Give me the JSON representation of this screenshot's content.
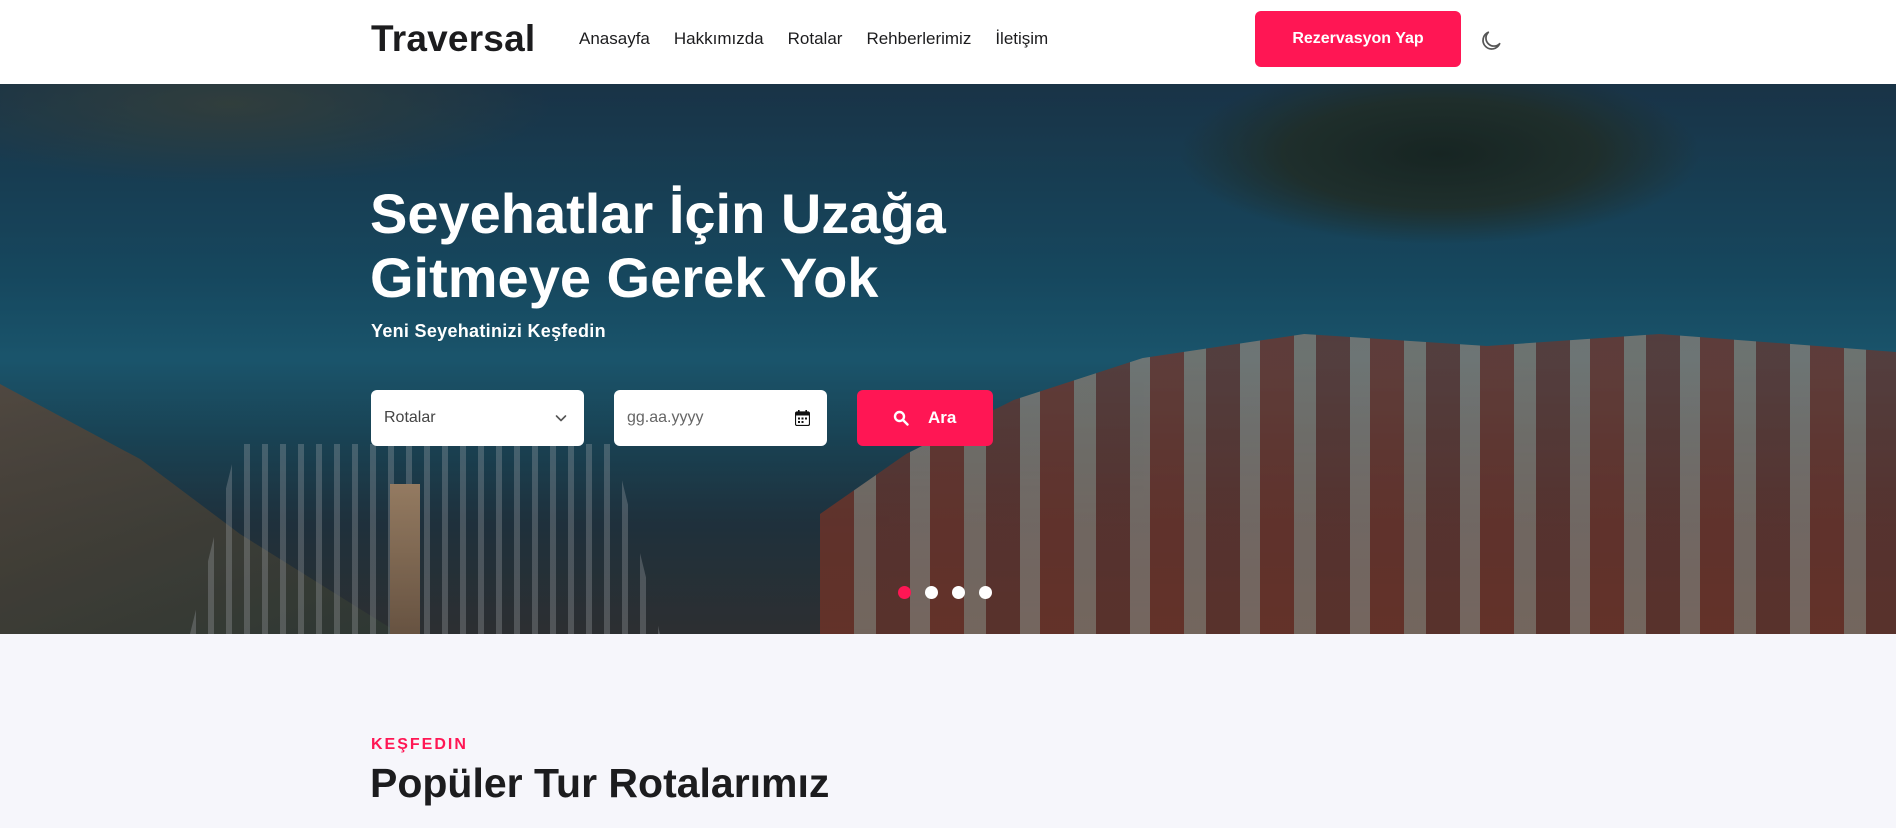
{
  "header": {
    "logo": "Traversal",
    "nav": [
      "Anasayfa",
      "Hakkımızda",
      "Rotalar",
      "Rehberlerimiz",
      "İletişim"
    ],
    "reserve_label": "Rezervasyon Yap",
    "theme_icon": "moon-icon"
  },
  "hero": {
    "title_line1": "Seyehatlar İçin Uzağa",
    "title_line2": "Gitmeye Gerek Yok",
    "subtitle": "Yeni Seyehatinizi Keşfedin",
    "route_select_value": "Rotalar",
    "date_placeholder": "gg.aa.yyyy",
    "search_label": "Ara",
    "slider_dots": 4,
    "active_dot": 1
  },
  "section": {
    "eyebrow": "KEŞFEDIN",
    "title": "Popüler Tur Rotalarımız"
  },
  "colors": {
    "accent": "#ff1654",
    "text_dark": "#1c1c1e",
    "section_bg": "#f6f6fb"
  }
}
